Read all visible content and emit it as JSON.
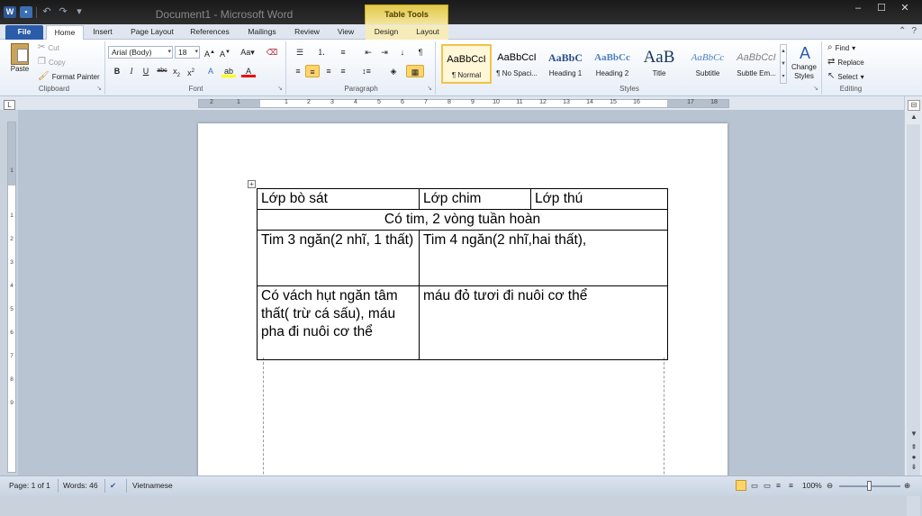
{
  "window": {
    "title": "Document1 - Microsoft Word",
    "context_tab_group": "Table Tools"
  },
  "qat": {
    "logo": "W",
    "save_icon": "save-icon",
    "undo_icon": "undo-icon",
    "redo_icon": "redo-icon"
  },
  "tabs": [
    {
      "label": "File"
    },
    {
      "label": "Home"
    },
    {
      "label": "Insert"
    },
    {
      "label": "Page Layout"
    },
    {
      "label": "References"
    },
    {
      "label": "Mailings"
    },
    {
      "label": "Review"
    },
    {
      "label": "View"
    },
    {
      "label": "Design"
    },
    {
      "label": "Layout"
    }
  ],
  "ribbon": {
    "clipboard": {
      "label": "Clipboard",
      "paste": "Paste",
      "cut": "Cut",
      "copy": "Copy",
      "format_painter": "Format Painter"
    },
    "font": {
      "label": "Font",
      "font_name": "Arial (Body)",
      "font_size": "18"
    },
    "paragraph": {
      "label": "Paragraph"
    },
    "styles": {
      "label": "Styles",
      "items": [
        {
          "preview": "AaBbCcI",
          "name": "¶ Normal"
        },
        {
          "preview": "AaBbCcI",
          "name": "¶ No Spaci..."
        },
        {
          "preview": "AaBbC",
          "name": "Heading 1"
        },
        {
          "preview": "AaBbCc",
          "name": "Heading 2"
        },
        {
          "preview": "AaB",
          "name": "Title"
        },
        {
          "preview": "AaBbCc",
          "name": "Subtitle"
        },
        {
          "preview": "AaBbCcI",
          "name": "Subtle Em..."
        }
      ],
      "change_styles": "Change Styles"
    },
    "editing": {
      "label": "Editing",
      "find": "Find",
      "replace": "Replace",
      "select": "Select"
    }
  },
  "ruler": {
    "marks": [
      "2",
      "1",
      "1",
      "2",
      "3",
      "4",
      "5",
      "6",
      "7",
      "8",
      "9",
      "10",
      "11",
      "12",
      "13",
      "14",
      "15",
      "16",
      "17",
      "18"
    ],
    "vmarks": [
      "1",
      "1",
      "2",
      "3",
      "4",
      "5",
      "6",
      "7",
      "8",
      "9"
    ]
  },
  "table": {
    "rows": [
      [
        "Lớp bò sát",
        "Lớp chim",
        "Lớp thú"
      ],
      [
        "Có tim, 2 vòng tuần hoàn"
      ],
      [
        "Tim 3 ngăn(2 nhĩ, 1 thất)",
        "Tim 4 ngăn(2 nhĩ,hai thất),"
      ],
      [
        "Có vách hụt ngăn tâm thất( trừ cá sấu), máu pha đi nuôi cơ thể",
        "máu đỏ tươi đi nuôi cơ thể"
      ]
    ]
  },
  "status": {
    "page": "Page: 1 of 1",
    "words": "Words: 46",
    "language": "Vietnamese",
    "zoom": "100%"
  },
  "colors": {
    "file_tab": "#2a5caa",
    "context_tab": "#e2c94a",
    "highlight": "#ffd46b"
  }
}
